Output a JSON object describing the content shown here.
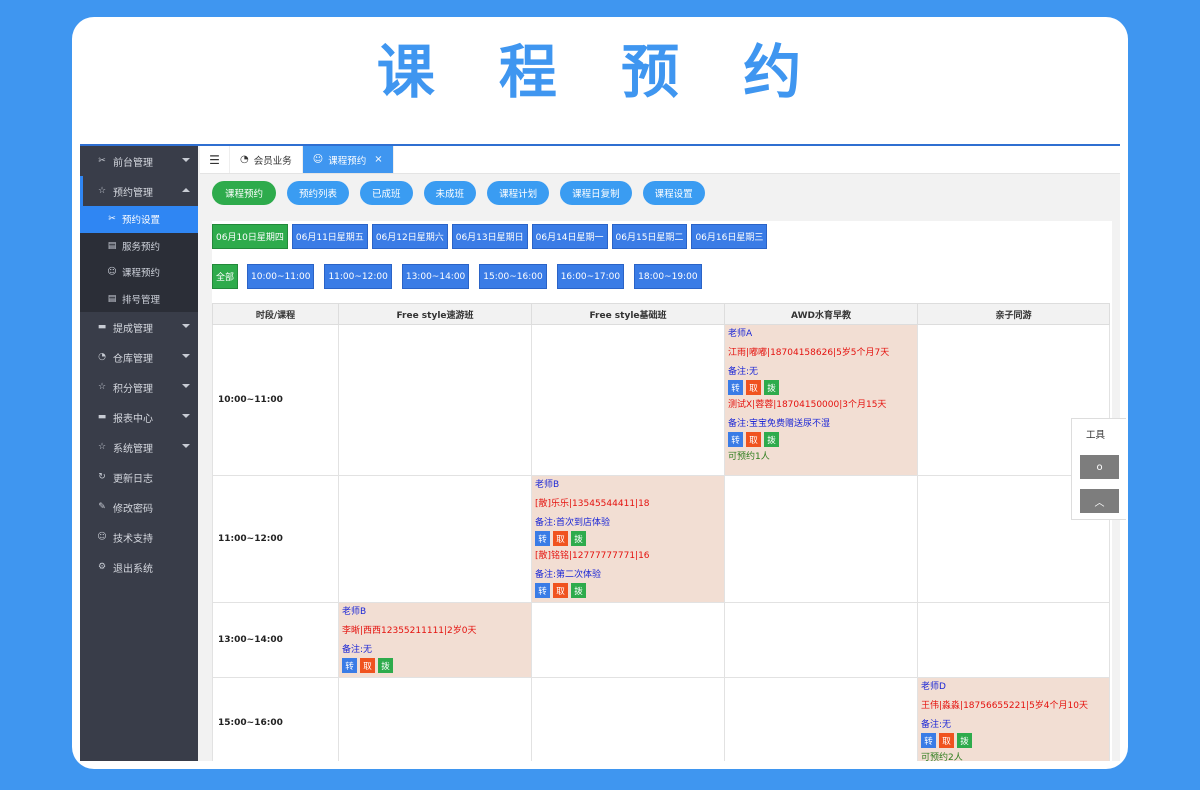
{
  "hero_title": "课 程 预 约",
  "sidebar": {
    "items": [
      {
        "icon": "wrench-icon",
        "glyph": "✂",
        "label": "前台管理",
        "arrow": "down"
      },
      {
        "icon": "star-icon",
        "glyph": "☆",
        "label": "预约管理",
        "arrow": "up",
        "open": true,
        "children": [
          {
            "icon": "wrench-icon",
            "glyph": "✂",
            "label": "预约设置",
            "active": true
          },
          {
            "icon": "clipboard-icon",
            "glyph": "▤",
            "label": "服务预约"
          },
          {
            "icon": "smile-icon",
            "glyph": "☺",
            "label": "课程预约"
          },
          {
            "icon": "clipboard-icon",
            "glyph": "▤",
            "label": "排号管理"
          }
        ]
      },
      {
        "icon": "monitor-icon",
        "glyph": "▬",
        "label": "提成管理",
        "arrow": "down"
      },
      {
        "icon": "dashboard-icon",
        "glyph": "◔",
        "label": "仓库管理",
        "arrow": "down"
      },
      {
        "icon": "star-icon",
        "glyph": "☆",
        "label": "积分管理",
        "arrow": "down"
      },
      {
        "icon": "monitor-icon",
        "glyph": "▬",
        "label": "报表中心",
        "arrow": "down"
      },
      {
        "icon": "star-icon",
        "glyph": "☆",
        "label": "系统管理",
        "arrow": "down"
      },
      {
        "icon": "refresh-icon",
        "glyph": "↻",
        "label": "更新日志"
      },
      {
        "icon": "edit-icon",
        "glyph": "✎",
        "label": "修改密码"
      },
      {
        "icon": "support-icon",
        "glyph": "☺",
        "label": "技术支持"
      },
      {
        "icon": "gears-icon",
        "glyph": "⚙",
        "label": "退出系统"
      }
    ]
  },
  "tabs": [
    {
      "icon": "dashboard-icon",
      "glyph": "◔",
      "label": "会员业务",
      "active": false
    },
    {
      "icon": "smile-icon",
      "glyph": "☺",
      "label": "课程预约",
      "active": true,
      "close": "×"
    }
  ],
  "tab_toggle_glyph": "☰",
  "toolbar_buttons": [
    {
      "label": "课程预约",
      "active": true
    },
    {
      "label": "预约列表"
    },
    {
      "label": "已成班"
    },
    {
      "label": "未成班"
    },
    {
      "label": "课程计划"
    },
    {
      "label": "课程日复制"
    },
    {
      "label": "课程设置"
    }
  ],
  "dates": [
    {
      "label": "06月10日星期四",
      "active": true
    },
    {
      "label": "06月11日星期五"
    },
    {
      "label": "06月12日星期六"
    },
    {
      "label": "06月13日星期日"
    },
    {
      "label": "06月14日星期一"
    },
    {
      "label": "06月15日星期二"
    },
    {
      "label": "06月16日星期三"
    }
  ],
  "time_filters": [
    {
      "label": "全部",
      "active": true
    },
    {
      "label": "10:00~11:00"
    },
    {
      "label": "11:00~12:00"
    },
    {
      "label": "13:00~14:00"
    },
    {
      "label": "15:00~16:00"
    },
    {
      "label": "16:00~17:00"
    },
    {
      "label": "18:00~19:00"
    }
  ],
  "table": {
    "headers": [
      "时段/课程",
      "Free style速游班",
      "Free style基础班",
      "AWD水育早教",
      "亲子同游"
    ],
    "action_labels": {
      "transfer": "转",
      "take": "取",
      "dial": "拨"
    },
    "rows": [
      {
        "time": "10:00~11:00",
        "cells": [
          null,
          null,
          {
            "teacher": "老师A",
            "bookings": [
              {
                "member": "江雨|嘟嘟|18704158626|5岁5个月7天",
                "note": "备注:无"
              },
              {
                "member": "测试X|蓉蓉|18704150000|3个月15天",
                "note": "备注:宝宝免费赠送尿不湿"
              }
            ],
            "avail": "可预约1人"
          },
          null
        ]
      },
      {
        "time": "11:00~12:00",
        "cells": [
          null,
          {
            "teacher": "老师B",
            "bookings": [
              {
                "member": "[散]乐乐|13545544411|18",
                "note": "备注:首次到店体验"
              },
              {
                "member": "[散]铭铭|12777777771|16",
                "note": "备注:第二次体验"
              }
            ]
          },
          null,
          null
        ]
      },
      {
        "time": "13:00~14:00",
        "cells": [
          {
            "teacher": "老师B",
            "bookings": [
              {
                "member": "李晰|西西12355211111|2岁0天",
                "note": "备注:无"
              }
            ]
          },
          null,
          null,
          null
        ]
      },
      {
        "time": "15:00~16:00",
        "cells": [
          null,
          null,
          null,
          {
            "teacher": "老师D",
            "bookings": [
              {
                "member": "王伟|淼淼|18756655221|5岁4个月10天",
                "note": "备注:无"
              }
            ],
            "avail": "可预约2人"
          }
        ]
      }
    ]
  },
  "tool_panel": {
    "title": "工具",
    "btn1": "o",
    "btn2": "︿"
  },
  "colors": {
    "accent": "#3f96f0",
    "green": "#2eab4c",
    "red_text": "#e4120e",
    "blue_text": "#1d28d6",
    "booked_cell": "#f2ded3"
  }
}
